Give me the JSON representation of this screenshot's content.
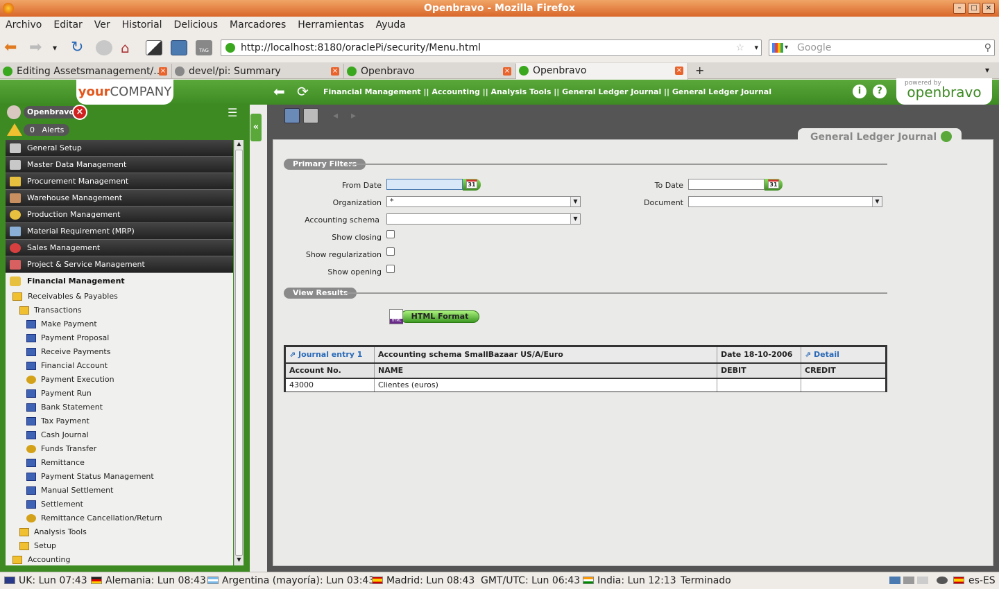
{
  "window": {
    "title": "Openbravo - Mozilla Firefox"
  },
  "menubar": [
    "Archivo",
    "Editar",
    "Ver",
    "Historial",
    "Delicious",
    "Marcadores",
    "Herramientas",
    "Ayuda"
  ],
  "navbar": {
    "url": "http://localhost:8180/oraclePi/security/Menu.html",
    "search_placeholder": "Google"
  },
  "tabs": [
    {
      "label": "Editing Assetsmanagement/...",
      "active": false
    },
    {
      "label": "devel/pi: Summary",
      "active": false
    },
    {
      "label": "Openbravo",
      "active": false
    },
    {
      "label": "Openbravo",
      "active": true
    }
  ],
  "header": {
    "logo_your": "your",
    "logo_company": "COMPANY",
    "breadcrumb": "Financial Management || Accounting || Analysis Tools || General Ledger Journal  ||  General Ledger Journal",
    "powered_by": "powered by",
    "powered_logo": "openbravo"
  },
  "user": {
    "name": "Openbravo",
    "alerts_count": "0",
    "alerts_label": "Alerts"
  },
  "menu": {
    "headers": [
      "General Setup",
      "Master Data Management",
      "Procurement Management",
      "Warehouse Management",
      "Production Management",
      "Material Requirement (MRP)",
      "Sales Management",
      "Project & Service Management"
    ],
    "open_header": "Financial Management",
    "items": [
      {
        "label": "Receivables & Payables",
        "level": 1,
        "icon": "folder"
      },
      {
        "label": "Transactions",
        "level": 2,
        "icon": "folder"
      },
      {
        "label": "Make Payment",
        "level": 3,
        "icon": "process"
      },
      {
        "label": "Payment Proposal",
        "level": 3,
        "icon": "process"
      },
      {
        "label": "Receive Payments",
        "level": 3,
        "icon": "process"
      },
      {
        "label": "Financial Account",
        "level": 3,
        "icon": "process"
      },
      {
        "label": "Payment Execution",
        "level": 3,
        "icon": "gear"
      },
      {
        "label": "Payment Run",
        "level": 3,
        "icon": "process"
      },
      {
        "label": "Bank Statement",
        "level": 3,
        "icon": "process"
      },
      {
        "label": "Tax Payment",
        "level": 3,
        "icon": "process"
      },
      {
        "label": "Cash Journal",
        "level": 3,
        "icon": "process"
      },
      {
        "label": "Funds Transfer",
        "level": 3,
        "icon": "gear"
      },
      {
        "label": "Remittance",
        "level": 3,
        "icon": "process"
      },
      {
        "label": "Payment Status Management",
        "level": 3,
        "icon": "process"
      },
      {
        "label": "Manual Settlement",
        "level": 3,
        "icon": "process"
      },
      {
        "label": "Settlement",
        "level": 3,
        "icon": "process"
      },
      {
        "label": "Remittance Cancellation/Return",
        "level": 3,
        "icon": "gear"
      },
      {
        "label": "Analysis Tools",
        "level": 2,
        "icon": "folder"
      },
      {
        "label": "Setup",
        "level": 2,
        "icon": "folder"
      },
      {
        "label": "Accounting",
        "level": 1,
        "icon": "folder"
      }
    ]
  },
  "content": {
    "window_title": "General Ledger Journal",
    "primary_filters": "Primary Filters",
    "view_results": "View Results",
    "fields": {
      "from_date": {
        "label": "From Date",
        "value": "",
        "cal": "31"
      },
      "to_date": {
        "label": "To Date",
        "value": "",
        "cal": "31"
      },
      "organization": {
        "label": "Organization",
        "value": "*"
      },
      "document": {
        "label": "Document",
        "value": ""
      },
      "accounting_schema": {
        "label": "Accounting schema",
        "value": ""
      },
      "show_closing": {
        "label": "Show closing",
        "checked": false
      },
      "show_regularization": {
        "label": "Show regularization",
        "checked": false
      },
      "show_opening": {
        "label": "Show opening",
        "checked": false
      }
    },
    "html_button": "HTML Format",
    "html_badge": "HTML"
  },
  "results": {
    "journal": "Journal entry 1",
    "schema": "Accounting schema SmallBazaar US/A/Euro",
    "date": "Date 18-10-2006",
    "detail": "Detail",
    "columns": [
      "Account No.",
      "NAME",
      "DEBIT",
      "CREDIT"
    ],
    "rows": [
      [
        "43000",
        "Clientes (euros)",
        "",
        ""
      ]
    ]
  },
  "statusbar": {
    "clocks": [
      "UK: Lun 07:43",
      "Alemania: Lun 08:43",
      "Argentina (mayoría): Lun 03:43",
      "Madrid: Lun 08:43",
      "GMT/UTC: Lun 06:43",
      "India: Lun 12:13"
    ],
    "status": "Terminado",
    "locale": "es-ES"
  }
}
